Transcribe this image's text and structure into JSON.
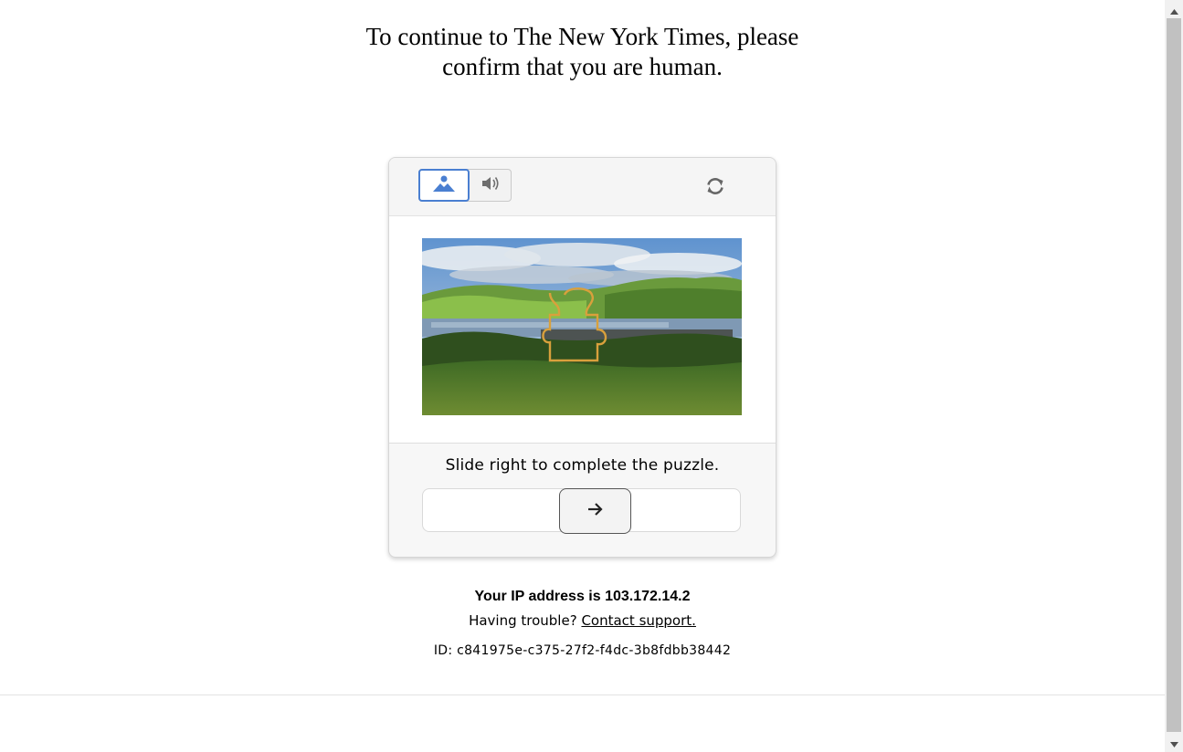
{
  "headline": {
    "line1": "To continue to The New York Times, please",
    "line2": "confirm that you are human."
  },
  "captcha": {
    "modes": [
      {
        "name": "image",
        "icon": "image-mountain-icon",
        "selected": true
      },
      {
        "name": "audio",
        "icon": "speaker-icon",
        "selected": false
      }
    ],
    "refresh_icon": "refresh-icon",
    "instruction": "Slide right to complete the puzzle.",
    "slider_icon": "arrow-right-icon",
    "colors": {
      "accent": "#4a7fd1",
      "puzzle_outline": "#d9a03c"
    }
  },
  "footer": {
    "ip_text": "Your IP address is 103.172.14.2",
    "trouble_text": "Having trouble?",
    "contact_link": "Contact support.",
    "id_text": "ID: c841975e-c375-27f2-f4dc-3b8fdbb38442"
  }
}
